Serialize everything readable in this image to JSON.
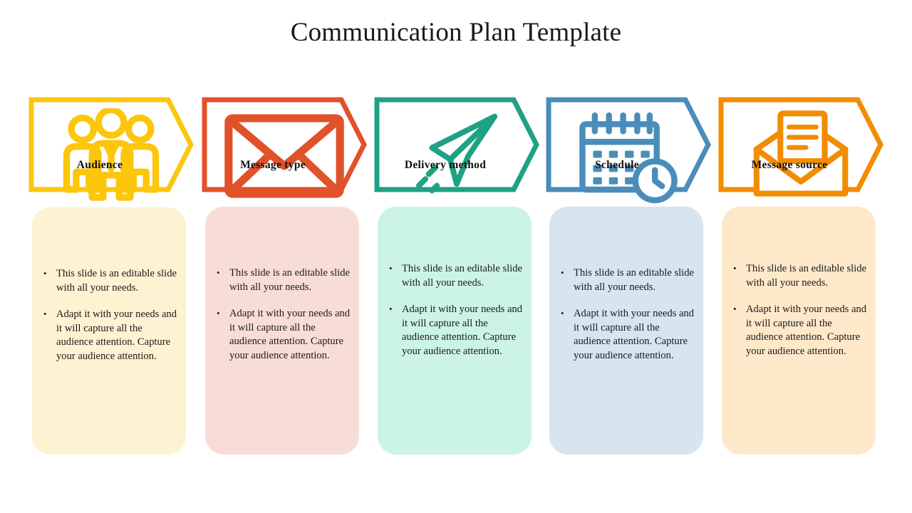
{
  "slide": {
    "title": "Communication Plan Template",
    "background_color": "#FFFFFF"
  },
  "steps": [
    {
      "label": "Audience",
      "icon": "people-group-icon",
      "accent_color": "#FCC60B",
      "card_color": "#FDF2D1",
      "bullets": [
        "This slide is an editable slide with all your needs.",
        "Adapt it with your needs and it will capture all the audience attention. Capture your audience attention."
      ]
    },
    {
      "label": "Message type",
      "icon": "envelope-icon",
      "accent_color": "#E1512A",
      "card_color": "#F8DDD6",
      "bullets": [
        "This slide is an editable slide with all your needs.",
        "Adapt it with your needs and it will capture all the audience attention. Capture your audience attention."
      ]
    },
    {
      "label": "Delivery method",
      "icon": "paper-plane-icon",
      "accent_color": "#1FA184",
      "card_color": "#CCF3E8",
      "bullets": [
        "This slide is an editable slide with all your needs.",
        "Adapt it with your needs and it will capture all the audience attention. Capture your audience attention."
      ]
    },
    {
      "label": "Schedule",
      "icon": "calendar-clock-icon",
      "accent_color": "#4A8DBA",
      "card_color": "#D6E5EF",
      "bullets": [
        "This slide is an editable slide with all your needs.",
        "Adapt it with your needs and it will capture all the audience attention. Capture your audience attention."
      ]
    },
    {
      "label": "Message source",
      "icon": "open-envelope-letter-icon",
      "accent_color": "#F28C00",
      "card_color": "#FDE8CA",
      "bullets": [
        "This slide is an editable slide with all your needs.",
        "Adapt it with your needs and it will capture all the audience attention. Capture your audience attention."
      ]
    }
  ]
}
